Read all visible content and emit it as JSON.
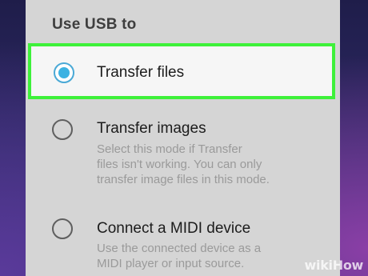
{
  "dialog": {
    "title": "Use USB to",
    "options": [
      {
        "label": "Transfer files",
        "selected": true,
        "description_lines": []
      },
      {
        "label": "Transfer images",
        "selected": false,
        "description_lines": [
          "Select this mode if Transfer",
          "files isn't working. You can only",
          "transfer image files in this mode."
        ]
      },
      {
        "label": "Connect a MIDI device",
        "selected": false,
        "description_lines": [
          "Use the connected device as a",
          "MIDI player or input source."
        ]
      }
    ]
  },
  "colors": {
    "highlight_border": "#3ef13a",
    "radio_selected": "#3cb2e2",
    "dialog_background": "#d5d5d5"
  },
  "icons": {
    "selected_radio": "radio-selected-icon",
    "unselected_radio": "radio-unselected-icon"
  },
  "watermark": {
    "text": "wikiHow"
  }
}
